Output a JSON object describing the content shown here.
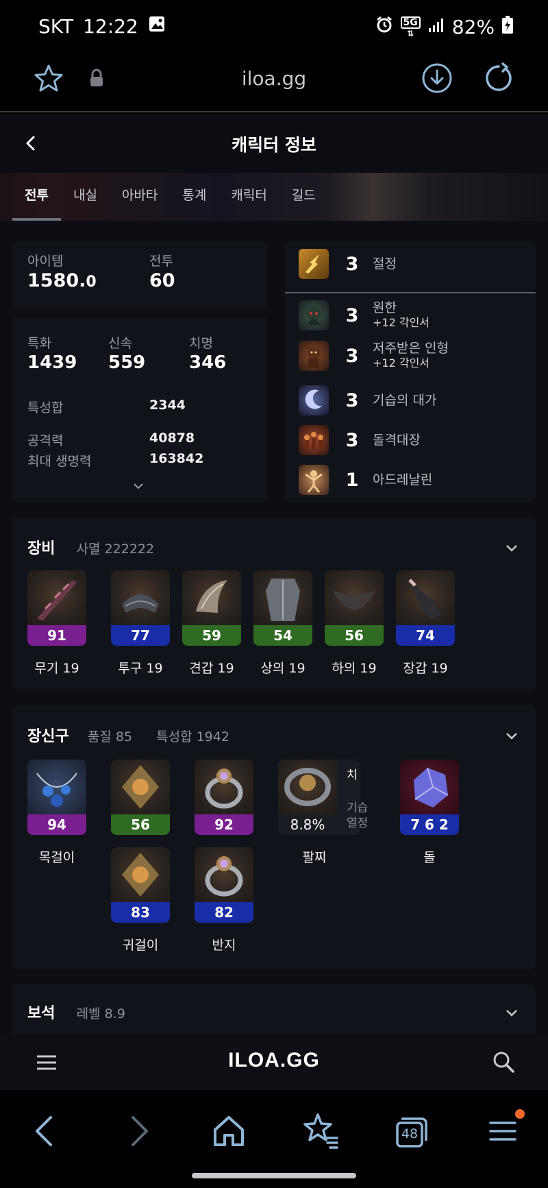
{
  "status_bar": {
    "carrier": "SKT",
    "time": "12:22",
    "network": "5G",
    "battery": "82%"
  },
  "browser": {
    "url": "iloa.gg"
  },
  "header": {
    "title": "캐릭터 정보"
  },
  "tabs": [
    "전투",
    "내실",
    "아바타",
    "통계",
    "캐릭터",
    "길드"
  ],
  "summary": {
    "item_label": "아이템",
    "item_value_main": "1580.",
    "item_value_decimal": "0",
    "combat_label": "전투",
    "combat_value": "60"
  },
  "stats": {
    "spec_label": "특화",
    "spec_value": "1439",
    "swift_label": "신속",
    "swift_value": "559",
    "crit_label": "치명",
    "crit_value": "346",
    "total_label": "특성합",
    "total_value": "2344",
    "attack_label": "공격력",
    "attack_value": "40878",
    "hp_label": "최대 생명력",
    "hp_value": "163842"
  },
  "engravings": [
    {
      "level": "3",
      "name": "절정",
      "sub": ""
    },
    {
      "level": "3",
      "name": "원한",
      "sub": "+12 각인서"
    },
    {
      "level": "3",
      "name": "저주받은 인형",
      "sub": "+12 각인서"
    },
    {
      "level": "3",
      "name": "기습의 대가",
      "sub": ""
    },
    {
      "level": "3",
      "name": "돌격대장",
      "sub": ""
    },
    {
      "level": "1",
      "name": "아드레날린",
      "sub": ""
    }
  ],
  "equipment": {
    "title": "장비",
    "subtitle": "사멸 222222",
    "items": [
      {
        "quality": "91",
        "name": "무기 19",
        "color": "#7a1f8f"
      },
      {
        "quality": "77",
        "name": "투구 19",
        "color": "#1a2da8"
      },
      {
        "quality": "59",
        "name": "견갑 19",
        "color": "#2f6b22"
      },
      {
        "quality": "54",
        "name": "상의 19",
        "color": "#2f6b22"
      },
      {
        "quality": "56",
        "name": "하의 19",
        "color": "#2f6b22"
      },
      {
        "quality": "74",
        "name": "장갑 19",
        "color": "#1a2da8"
      }
    ]
  },
  "accessories": {
    "title": "장신구",
    "quality_label": "품질 85",
    "total_label": "특성합 1942",
    "necklace": {
      "quality": "94",
      "name": "목걸이"
    },
    "earring1": {
      "quality": "56"
    },
    "earring2": {
      "quality": "83",
      "name": "귀걸이"
    },
    "ring1": {
      "quality": "92"
    },
    "ring2": {
      "quality": "82",
      "name": "반지"
    },
    "bracelet": {
      "value": "8.8%",
      "name": "팔찌",
      "opt1": "치",
      "opt2": "기습",
      "opt3": "열정"
    },
    "stone": {
      "value": "7 6 2",
      "name": "돌"
    }
  },
  "gems": {
    "title": "보석",
    "subtitle": "레벨 8.9"
  },
  "site": {
    "logo": "ILOA.GG"
  },
  "nav": {
    "tabs_count": "48"
  }
}
